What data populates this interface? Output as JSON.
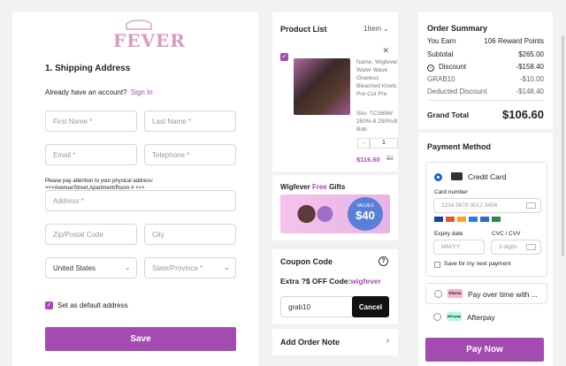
{
  "logo_text": "FEVER",
  "shipping": {
    "title": "1. Shipping Address",
    "account_prompt": "Already have an account?",
    "sign_in": "Sign In",
    "first_name": "First Name *",
    "last_name": "Last Name *",
    "email": "Email *",
    "telephone": "Telephone *",
    "note": "Please pay attention to your physical address: ×××Avenue/Street,Apartment/Room # ×××",
    "address": "Address *",
    "zip": "Zip/Postal Code",
    "city": "City",
    "country": "United States",
    "state": "State/Province *",
    "default_label": "Set as default address",
    "save": "Save"
  },
  "product_list": {
    "title": "Product List",
    "count": "1Item",
    "name": "Name: Wigfever Water Wave Glueless Bleached Knots Pre-Cut Pre Plucked HD Lace Wig",
    "sku": "Sku: TCS69W 250%-8 250%/8 Bob",
    "qty_minus": "-",
    "qty": "1",
    "price": "$116.60",
    "old_price": "$2"
  },
  "gifts": {
    "title_prefix": "Wigfever ",
    "title_highlight": "Free",
    "title_suffix": " Gifts",
    "banner_values": "VALUES",
    "banner_amount": "$40"
  },
  "coupon": {
    "title": "Coupon Code",
    "help": "?",
    "promo_prefix": "Extra ?$ OFF Code:",
    "promo_code": "wigfever",
    "value": "grab10",
    "cancel": "Cancel"
  },
  "order_note": {
    "title": "Add Order Note"
  },
  "summary": {
    "title": "Order Summary",
    "you_earn": "You Earn",
    "reward": "106 Reward Points",
    "subtotal_label": "Subtotal",
    "subtotal": "$265.00",
    "discount_label": "Discount",
    "discount": "-$158.40",
    "code_label": "GRAB10",
    "code_value": "-$10.00",
    "deducted_label": "Deducted Discount",
    "deducted": "-$148.40",
    "total_label": "Grand Total",
    "total": "$106.60"
  },
  "payment": {
    "title": "Payment Method",
    "credit_card": "Credit Card",
    "card_number_label": "Card number",
    "card_number_placeholder": "1234 5678 9012 3456",
    "expiry_label": "Expiry date",
    "expiry_placeholder": "MM/YY",
    "cvc_label": "CVC / CVV",
    "cvc_placeholder": "3 digits",
    "save_label": "Save for my next payment",
    "klarna_badge": "Klarna",
    "klarna_text": "Pay over time with ...",
    "afterpay_badge": "afterpay",
    "afterpay_text": "Afterpay",
    "pay_now": "Pay Now"
  },
  "colors": {
    "accent": "#a34bb0",
    "link": "#a34bb0",
    "radio": "#1a5fd6"
  }
}
